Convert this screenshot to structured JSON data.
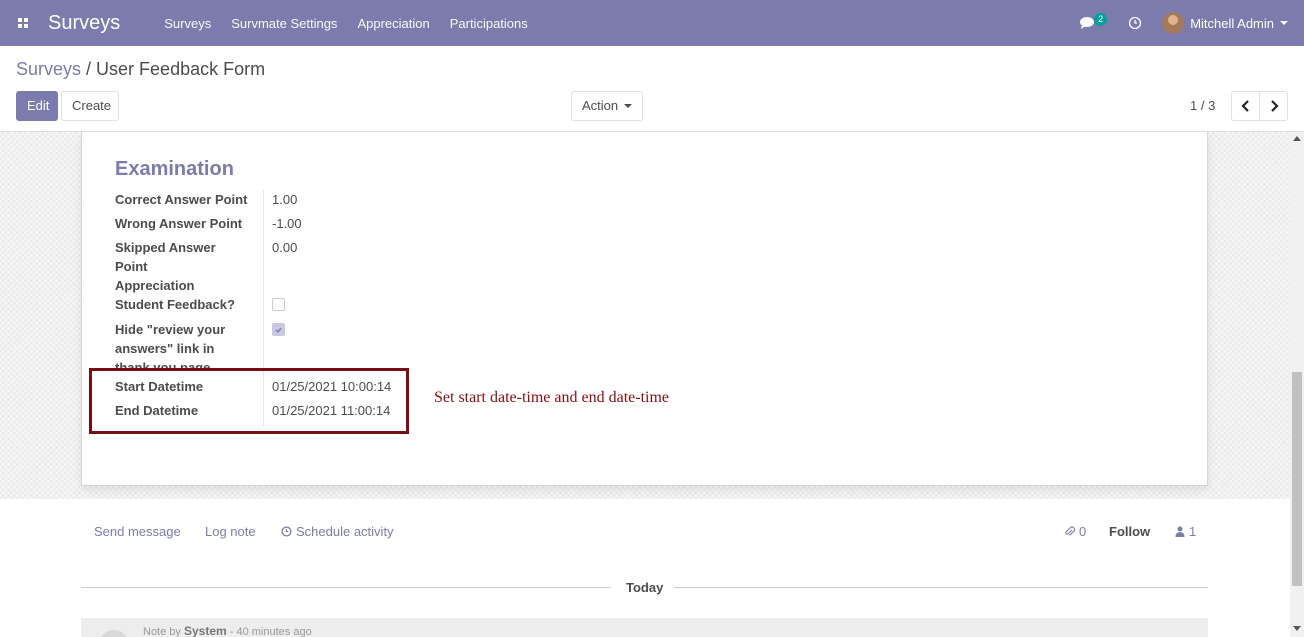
{
  "navbar": {
    "app_name": "Surveys",
    "menu": [
      "Surveys",
      "Survmate Settings",
      "Appreciation",
      "Participations"
    ],
    "message_count": "2",
    "user_name": "Mitchell Admin"
  },
  "breadcrumb": {
    "parent": "Surveys",
    "separator": " / ",
    "current": "User Feedback Form"
  },
  "toolbar": {
    "edit_label": "Edit",
    "create_label": "Create",
    "action_label": "Action"
  },
  "pager": {
    "value": "1 / 3"
  },
  "form": {
    "group_title": "Examination",
    "fields": {
      "correct_label": "Correct Answer Point",
      "correct_value": "1.00",
      "wrong_label": "Wrong Answer Point",
      "wrong_value": "-1.00",
      "skipped_label": "Skipped Answer Point",
      "skipped_value": "0.00",
      "appreciation_label": "Appreciation Student Feedback?",
      "appreciation_checked": false,
      "hide_review_label": "Hide \"review your answers\" link in thank you page",
      "hide_review_checked": true,
      "start_label": "Start Datetime",
      "start_value": "01/25/2021 10:00:14",
      "end_label": "End Datetime",
      "end_value": "01/25/2021 11:00:14"
    }
  },
  "annotation": "Set start date-time and end date-time",
  "chatter": {
    "send_message": "Send message",
    "log_note": "Log note",
    "schedule_activity": "Schedule activity",
    "attachments": "0",
    "follow": "Follow",
    "followers": "1",
    "today": "Today",
    "message_prefix": "Note by",
    "message_author": "System",
    "message_time": "- 40 minutes ago"
  },
  "colors": {
    "brand": "#7c7bad",
    "annotation_red": "#8b0d12"
  }
}
